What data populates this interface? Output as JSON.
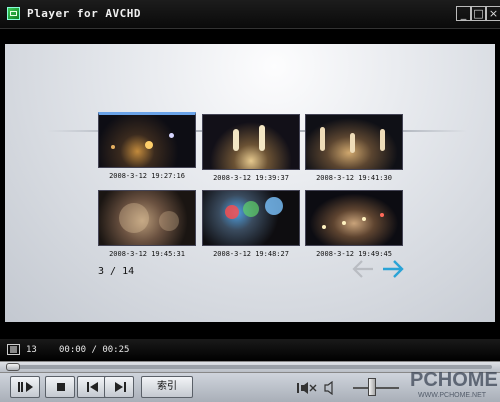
{
  "window": {
    "title": "Player for AVCHD",
    "min_glyph": "_",
    "max_glyph": "□",
    "close_glyph": "×"
  },
  "thumbnails": [
    {
      "timestamp": "2008-3-12 19:27:16",
      "selected": true
    },
    {
      "timestamp": "2008-3-12 19:39:37",
      "selected": false
    },
    {
      "timestamp": "2008-3-12 19:41:30",
      "selected": false
    },
    {
      "timestamp": "2008-3-12 19:45:31",
      "selected": false
    },
    {
      "timestamp": "2008-3-12 19:48:27",
      "selected": false
    },
    {
      "timestamp": "2008-3-12 19:49:45",
      "selected": false
    }
  ],
  "pager": {
    "page_text": "3 / 14"
  },
  "status": {
    "clip_count": "13",
    "time": "00:00 / 00:25"
  },
  "controls": {
    "index_label": "索引"
  },
  "watermark": {
    "brand": "PCHOME",
    "url": "WWW.PCHOME.NET"
  },
  "colors": {
    "accent": "#2aa3d6",
    "selection": "#6aa3e8"
  }
}
